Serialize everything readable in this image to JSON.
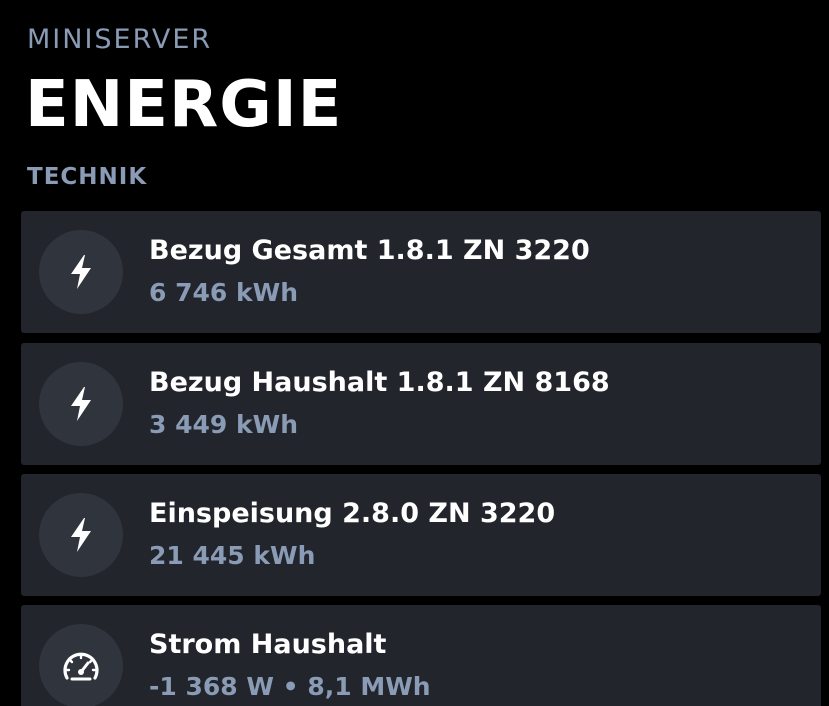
{
  "header": {
    "eyebrow": "MINISERVER",
    "title": "ENERGIE",
    "section": "TECHNIK"
  },
  "colors": {
    "background": "#000000",
    "card": "#22252b",
    "icon_bg": "#30343c",
    "muted_text": "#8a9bb5",
    "primary_text": "#ffffff"
  },
  "cards": [
    {
      "icon": "lightning-bolt-icon",
      "title": "Bezug Gesamt 1.8.1 ZN 3220",
      "value": "6 746 kWh"
    },
    {
      "icon": "lightning-bolt-icon",
      "title": "Bezug Haushalt 1.8.1 ZN 8168",
      "value": "3 449 kWh"
    },
    {
      "icon": "lightning-bolt-icon",
      "title": "Einspeisung 2.8.0 ZN 3220",
      "value": "21 445 kWh"
    },
    {
      "icon": "speedometer-icon",
      "title": "Strom Haushalt",
      "value": "-1 368 W • 8,1 MWh"
    }
  ]
}
